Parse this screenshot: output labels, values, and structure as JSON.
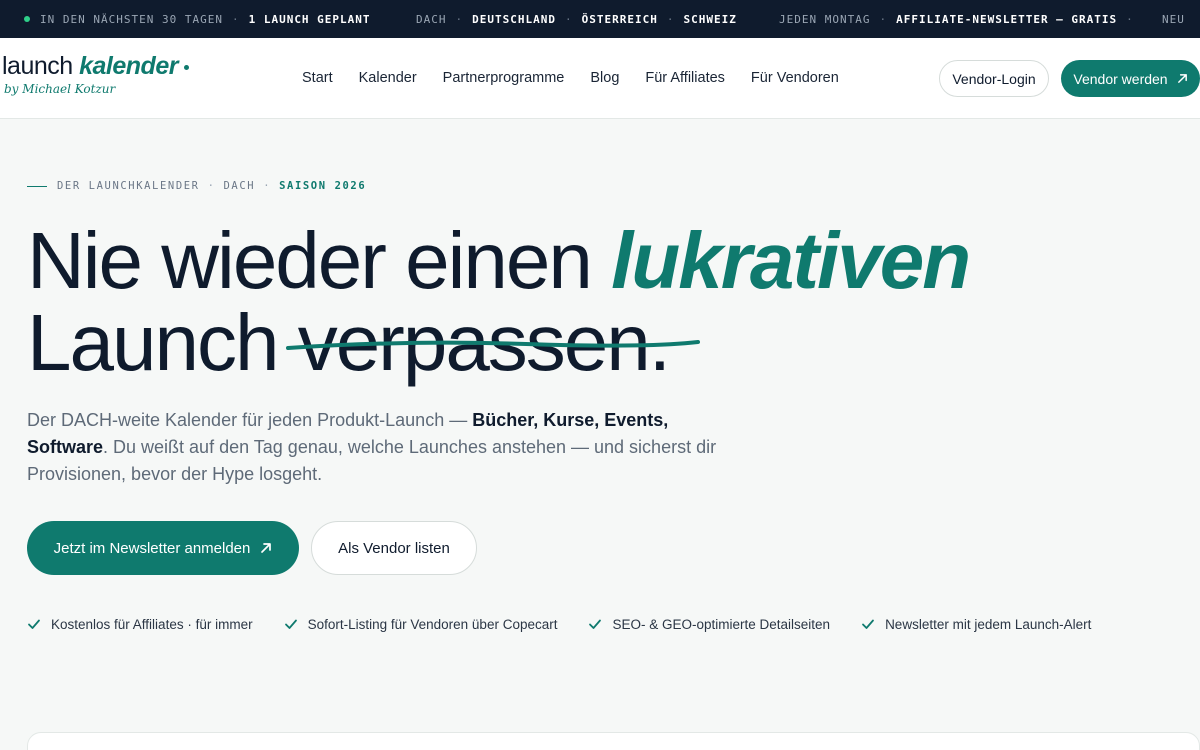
{
  "ticker": {
    "group1": {
      "dim": "IN DEN NÄCHSTEN 30 TAGEN",
      "strong": "1 LAUNCH GEPLANT"
    },
    "group2": {
      "dim": "DACH",
      "items": [
        "DEUTSCHLAND",
        "ÖSTERREICH",
        "SCHWEIZ"
      ]
    },
    "group3": {
      "dim": "JEDEN MONTAG",
      "strong": "AFFILIATE-NEWSLETTER — GRATIS"
    },
    "group4": {
      "dim": "NEU"
    },
    "separator": "·",
    "live_dot_color": "#2fd08a"
  },
  "header": {
    "logo": {
      "word1": "launch",
      "word2": "kalender",
      "byline": "by Michael Kotzur"
    },
    "nav": [
      "Start",
      "Kalender",
      "Partnerprogramme",
      "Blog",
      "Für Affiliates",
      "Für Vendoren"
    ],
    "login_label": "Vendor-Login",
    "cta_label": "Vendor werden",
    "cta_icon": "arrow-up-right-icon"
  },
  "hero": {
    "eyebrow": {
      "part1": "DER LAUNCHKALENDER",
      "part2": "DACH",
      "part3": "SAISON 2026",
      "separator": "·"
    },
    "headline": {
      "line1_plain": "Nie wieder einen ",
      "line1_accent": "lukrativen",
      "line2_plain": "Launch ",
      "line2_struck": "verpassen",
      "line2_end": "."
    },
    "lead": {
      "t1": "Der DACH-weite Kalender für jeden Produkt-Launch — ",
      "b1": "Bücher, Kurse, Events, Software",
      "t2": ". Du weißt auf den Tag genau, welche Launches anstehen — und sicherst dir Provisionen, bevor der Hype losgeht."
    },
    "primary_cta": "Jetzt im Newsletter anmelden",
    "secondary_cta": "Als Vendor listen",
    "features": [
      "Kostenlos für Affiliates · für immer",
      "Sofort-Listing für Vendoren über Copecart",
      "SEO- & GEO-optimierte Detailseiten",
      "Newsletter mit jedem Launch-Alert"
    ]
  },
  "colors": {
    "accent": "#0f7a6e",
    "navy": "#0f1b2d",
    "background": "#f6f8f7"
  }
}
